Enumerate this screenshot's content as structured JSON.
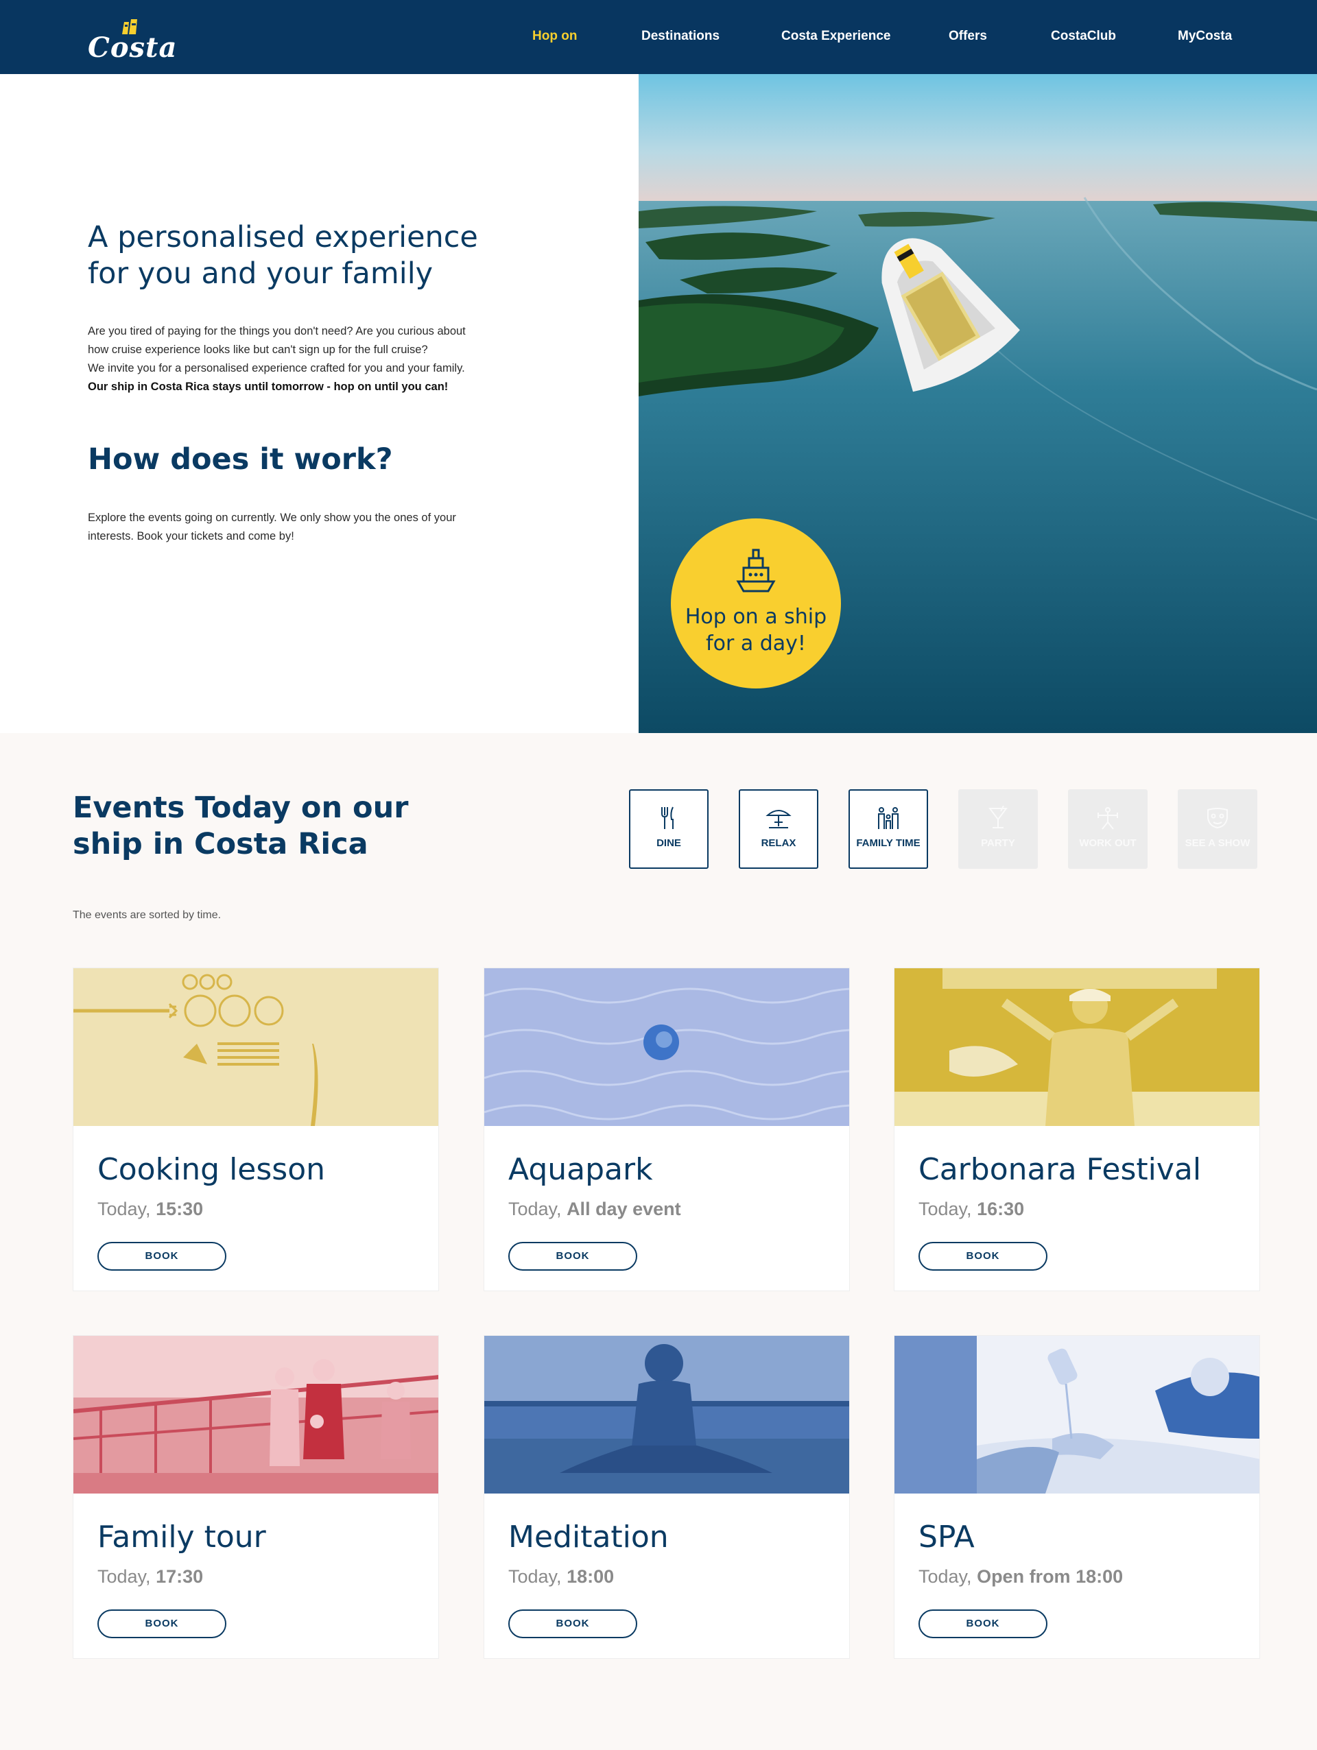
{
  "header": {
    "logo_text": "Costa",
    "nav": [
      {
        "label": "Hop on",
        "active": true
      },
      {
        "label": "Destinations"
      },
      {
        "label": "Costa Experience"
      },
      {
        "label": "Offers"
      },
      {
        "label": "CostaClub"
      },
      {
        "label": "MyCosta"
      }
    ]
  },
  "hero": {
    "title": "A personalised experience for you and your family",
    "intro_lines": [
      "Are you tired of paying for the things you don't need? Are you curious about",
      "how cruise experience looks like but can't sign up for the full cruise?",
      "We invite you for a personalised experience crafted for you and your family."
    ],
    "intro_bold": "Our ship in Costa Rica stays until tomorrow - hop on until you can!",
    "how_title": "How does it work?",
    "how_text": "Explore the events going on currently. We only show you the ones of your interests. Book your tickets and come by!",
    "badge_text": "Hop on a ship for a day!"
  },
  "events": {
    "title": "Events Today on our ship in Costa Rica",
    "sorted_note": "The events are sorted by time.",
    "filters": [
      {
        "label": "DINE",
        "icon": "cutlery-icon",
        "active": true
      },
      {
        "label": "RELAX",
        "icon": "umbrella-icon",
        "active": true
      },
      {
        "label": "FAMILY TIME",
        "icon": "family-icon",
        "active": true
      },
      {
        "label": "PARTY",
        "icon": "cocktail-icon",
        "active": false
      },
      {
        "label": "WORK OUT",
        "icon": "dumbbell-icon",
        "active": false
      },
      {
        "label": "SEE A SHOW",
        "icon": "mask-icon",
        "active": false
      }
    ],
    "cards": [
      {
        "title": "Cooking lesson",
        "day": "Today, ",
        "time": "15:30",
        "button": "BOOK",
        "tint": "#efe2b4"
      },
      {
        "title": "Aquapark",
        "day": "Today, ",
        "time": "All day event",
        "button": "BOOK",
        "tint": "#aab9e4"
      },
      {
        "title": "Carbonara Festival",
        "day": "Today, ",
        "time": "16:30",
        "button": "BOOK",
        "tint": "#d6b73b"
      },
      {
        "title": "Family tour",
        "day": "Today, ",
        "time": "17:30",
        "button": "BOOK",
        "tint": "#e39aa0"
      },
      {
        "title": "Meditation",
        "day": "Today, ",
        "time": "18:00",
        "button": "BOOK",
        "tint": "#4d76b4"
      },
      {
        "title": "SPA",
        "day": "Today, ",
        "time": "Open from 18:00",
        "button": "BOOK",
        "tint": "#3a6ab4"
      }
    ]
  }
}
